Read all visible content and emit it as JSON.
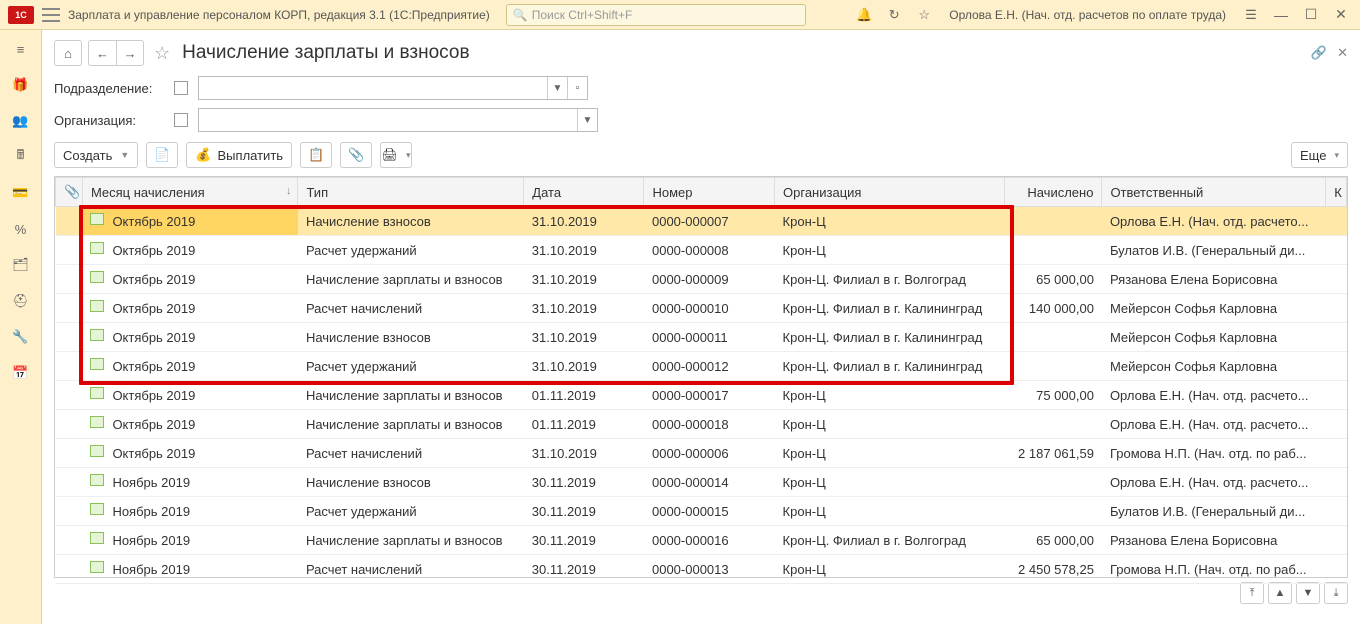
{
  "app": {
    "title": "Зарплата и управление персоналом КОРП, редакция 3.1  (1С:Предприятие)",
    "search_placeholder": "Поиск Ctrl+Shift+F",
    "user": "Орлова Е.Н. (Нач. отд. расчетов по оплате труда)"
  },
  "page": {
    "title": "Начисление зарплаты и взносов"
  },
  "filters": {
    "division_label": "Подразделение:",
    "org_label": "Организация:"
  },
  "toolbar": {
    "create": "Создать",
    "pay": "Выплатить",
    "more": "Еще"
  },
  "columns": {
    "month": "Месяц начисления",
    "type": "Тип",
    "date": "Дата",
    "number": "Номер",
    "org": "Организация",
    "amount": "Начислено",
    "resp": "Ответственный",
    "last": "К"
  },
  "rows": [
    {
      "month": "Октябрь 2019",
      "type": "Начисление взносов",
      "date": "31.10.2019",
      "number": "0000-000007",
      "org": "Крон-Ц",
      "amount": "",
      "resp": "Орлова Е.Н. (Нач. отд. расчето...",
      "selected": true
    },
    {
      "month": "Октябрь 2019",
      "type": "Расчет удержаний",
      "date": "31.10.2019",
      "number": "0000-000008",
      "org": "Крон-Ц",
      "amount": "",
      "resp": "Булатов И.В. (Генеральный ди..."
    },
    {
      "month": "Октябрь 2019",
      "type": "Начисление зарплаты и взносов",
      "date": "31.10.2019",
      "number": "0000-000009",
      "org": "Крон-Ц. Филиал в г. Волгоград",
      "amount": "65 000,00",
      "resp": "Рязанова Елена Борисовна"
    },
    {
      "month": "Октябрь 2019",
      "type": "Расчет начислений",
      "date": "31.10.2019",
      "number": "0000-000010",
      "org": "Крон-Ц. Филиал в г. Калининград",
      "amount": "140 000,00",
      "resp": "Мейерсон Софья Карловна"
    },
    {
      "month": "Октябрь 2019",
      "type": "Начисление взносов",
      "date": "31.10.2019",
      "number": "0000-000011",
      "org": "Крон-Ц. Филиал в г. Калининград",
      "amount": "",
      "resp": "Мейерсон Софья Карловна"
    },
    {
      "month": "Октябрь 2019",
      "type": "Расчет удержаний",
      "date": "31.10.2019",
      "number": "0000-000012",
      "org": "Крон-Ц. Филиал в г. Калининград",
      "amount": "",
      "resp": "Мейерсон Софья Карловна"
    },
    {
      "month": "Октябрь 2019",
      "type": "Начисление зарплаты и взносов",
      "date": "01.11.2019",
      "number": "0000-000017",
      "org": "Крон-Ц",
      "amount": "75 000,00",
      "resp": "Орлова Е.Н. (Нач. отд. расчето..."
    },
    {
      "month": "Октябрь 2019",
      "type": "Начисление зарплаты и взносов",
      "date": "01.11.2019",
      "number": "0000-000018",
      "org": "Крон-Ц",
      "amount": "",
      "resp": "Орлова Е.Н. (Нач. отд. расчето..."
    },
    {
      "month": "Октябрь 2019",
      "type": "Расчет начислений",
      "date": "31.10.2019",
      "number": "0000-000006",
      "org": "Крон-Ц",
      "amount": "2 187 061,59",
      "resp": "Громова Н.П. (Нач. отд. по раб..."
    },
    {
      "month": "Ноябрь 2019",
      "type": "Начисление взносов",
      "date": "30.11.2019",
      "number": "0000-000014",
      "org": "Крон-Ц",
      "amount": "",
      "resp": "Орлова Е.Н. (Нач. отд. расчето..."
    },
    {
      "month": "Ноябрь 2019",
      "type": "Расчет удержаний",
      "date": "30.11.2019",
      "number": "0000-000015",
      "org": "Крон-Ц",
      "amount": "",
      "resp": "Булатов И.В. (Генеральный ди..."
    },
    {
      "month": "Ноябрь 2019",
      "type": "Начисление зарплаты и взносов",
      "date": "30.11.2019",
      "number": "0000-000016",
      "org": "Крон-Ц. Филиал в г. Волгоград",
      "amount": "65 000,00",
      "resp": "Рязанова Елена Борисовна"
    },
    {
      "month": "Ноябрь 2019",
      "type": "Расчет начислений",
      "date": "30.11.2019",
      "number": "0000-000013",
      "org": "Крон-Ц",
      "amount": "2 450 578,25",
      "resp": "Громова Н.П. (Нач. отд. по раб..."
    }
  ]
}
